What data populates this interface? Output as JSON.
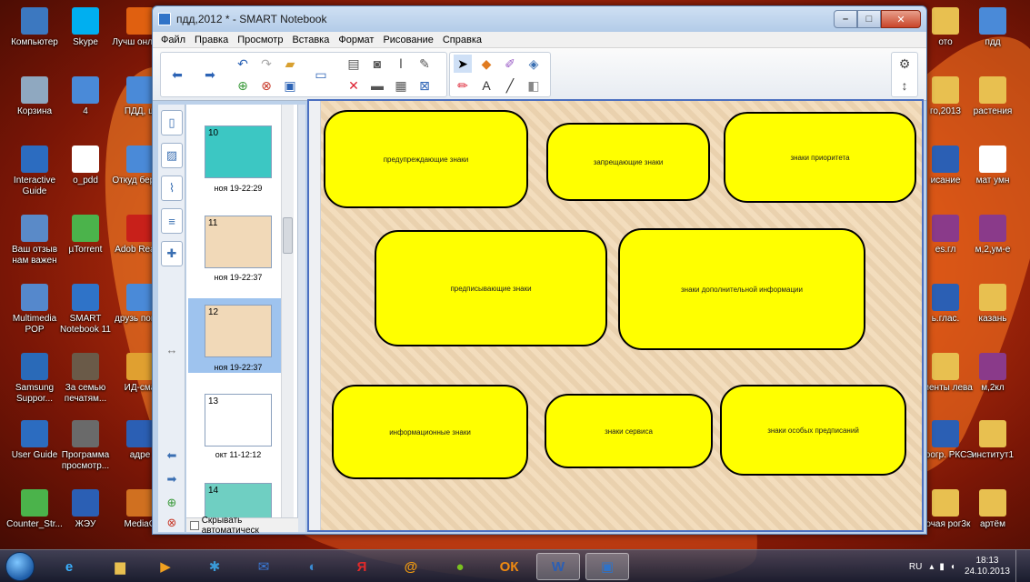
{
  "desktop": {
    "left_icons": [
      {
        "label": "Компьютер",
        "icon": "computer-icon",
        "color": "#3c78c0"
      },
      {
        "label": "Skype",
        "icon": "skype-icon",
        "color": "#00aff0"
      },
      {
        "label": "Лучш онлайн",
        "icon": "shortcut-icon",
        "color": "#e06010"
      },
      {
        "label": "Корзина",
        "icon": "recycle-bin-icon",
        "color": "#8fa8c0"
      },
      {
        "label": "4",
        "icon": "document-icon",
        "color": "#4a8ad8"
      },
      {
        "label": "ПДД, ш",
        "icon": "document-icon",
        "color": "#4a8ad8"
      },
      {
        "label": "Interactive Guide",
        "icon": "interactive-guide-icon",
        "color": "#2c6cc0"
      },
      {
        "label": "o_pdd",
        "icon": "music-file-icon",
        "color": "#ffffff"
      },
      {
        "label": "Откуд берутс",
        "icon": "document-icon",
        "color": "#4a8ad8"
      },
      {
        "label": "Ваш отзыв нам важен",
        "icon": "feedback-icon",
        "color": "#5a8ac8"
      },
      {
        "label": "µTorrent",
        "icon": "utorrent-icon",
        "color": "#4bb34b"
      },
      {
        "label": "Adob Reade",
        "icon": "pdf-icon",
        "color": "#c8201a"
      },
      {
        "label": "Multimedia POP",
        "icon": "multimedia-icon",
        "color": "#5588cc"
      },
      {
        "label": "SMART Notebook 11",
        "icon": "smart-notebook-icon",
        "color": "#2f73c8"
      },
      {
        "label": "друзь помог",
        "icon": "document-icon",
        "color": "#4a8ad8"
      },
      {
        "label": "Samsung Suppor...",
        "icon": "samsung-icon",
        "color": "#2a6ab8"
      },
      {
        "label": "За семью печатям...",
        "icon": "book-icon",
        "color": "#6a5a48"
      },
      {
        "label": "ИД-сма",
        "icon": "document-icon",
        "color": "#e0a030"
      },
      {
        "label": "User Guide",
        "icon": "user-guide-icon",
        "color": "#2c6cc0"
      },
      {
        "label": "Программа просмотр...",
        "icon": "viewer-icon",
        "color": "#6a6a6a"
      },
      {
        "label": "адре",
        "icon": "word-doc-icon",
        "color": "#2b5fb4"
      },
      {
        "label": "Counter_Str...",
        "icon": "utorrent-icon",
        "color": "#4bb34b"
      },
      {
        "label": "ЖЭУ",
        "icon": "word-doc-icon",
        "color": "#2b5fb4"
      },
      {
        "label": "MediaG",
        "icon": "media-icon",
        "color": "#d07020"
      }
    ],
    "right_icons": [
      {
        "label": "ото",
        "icon": "folder-icon",
        "color": "#e8c050"
      },
      {
        "label": "пдд",
        "icon": "document-icon",
        "color": "#4a8ad8"
      },
      {
        "label": "го,2013",
        "icon": "folder-icon",
        "color": "#e8c050"
      },
      {
        "label": "растения",
        "icon": "folder-icon",
        "color": "#e8c050"
      },
      {
        "label": "исание",
        "icon": "word-doc-icon",
        "color": "#2b5fb4"
      },
      {
        "label": "мат умн",
        "icon": "image-icon",
        "color": "#ffffff"
      },
      {
        "label": "es.гл",
        "icon": "rar-icon",
        "color": "#8a3a8a"
      },
      {
        "label": "м,2,ум-е",
        "icon": "rar-icon",
        "color": "#8a3a8a"
      },
      {
        "label": "ь.глас.",
        "icon": "word-doc-icon",
        "color": "#2b5fb4"
      },
      {
        "label": "казань",
        "icon": "folder-icon",
        "color": "#e8c050"
      },
      {
        "label": "ументы лева",
        "icon": "folder-icon",
        "color": "#e8c050"
      },
      {
        "label": "м,2кл",
        "icon": "rar-icon",
        "color": "#8a3a8a"
      },
      {
        "label": ".прогр. РКСЭ",
        "icon": "word-doc-icon",
        "color": "#2b5fb4"
      },
      {
        "label": "институт1",
        "icon": "folder-icon",
        "color": "#e8c050"
      },
      {
        "label": "бочая рог3к",
        "icon": "folder-icon",
        "color": "#e8c050"
      },
      {
        "label": "артём",
        "icon": "folder-icon",
        "color": "#e8c050"
      }
    ]
  },
  "window": {
    "title": "пдд,2012 * - SMART Notebook",
    "menu": [
      "Файл",
      "Правка",
      "Просмотр",
      "Вставка",
      "Формат",
      "Рисование",
      "Справка"
    ]
  },
  "side_panel": {
    "hide_label": "Скрывать автоматическ",
    "thumbnails": [
      {
        "number": "10",
        "date": "ноя 19-22:29",
        "bg": "#3cc7c3"
      },
      {
        "number": "11",
        "date": "ноя 19-22:37",
        "bg": "#f1d9b8"
      },
      {
        "number": "12",
        "date": "ноя 19-22:37",
        "bg": "#f1d9b8"
      },
      {
        "number": "13",
        "date": "окт 11-12:12",
        "bg": "#ffffff"
      },
      {
        "number": "14",
        "date": "",
        "bg": "#6fcfc2"
      }
    ]
  },
  "canvas": {
    "signs": [
      {
        "label": "предупреждающие знаки"
      },
      {
        "label": "запрещающие знаки"
      },
      {
        "label": "знаки приоритета"
      },
      {
        "label": "предписывающие знаки"
      },
      {
        "label": "знаки дополнительной информации"
      },
      {
        "label": "информационные знаки"
      },
      {
        "label": "знаки сервиса"
      },
      {
        "label": "знаки особых предписаний"
      }
    ]
  },
  "taskbar": {
    "language": "RU",
    "time": "18:13",
    "date": "24.10.2013",
    "apps": [
      "media-player-icon",
      "people-icon",
      "mail-icon",
      "speaker-icon",
      "yandex-icon",
      "mail-ru-icon",
      "browser-icon",
      "odnoklassniki-icon",
      "word-icon",
      "smart-notebook-icon"
    ]
  }
}
